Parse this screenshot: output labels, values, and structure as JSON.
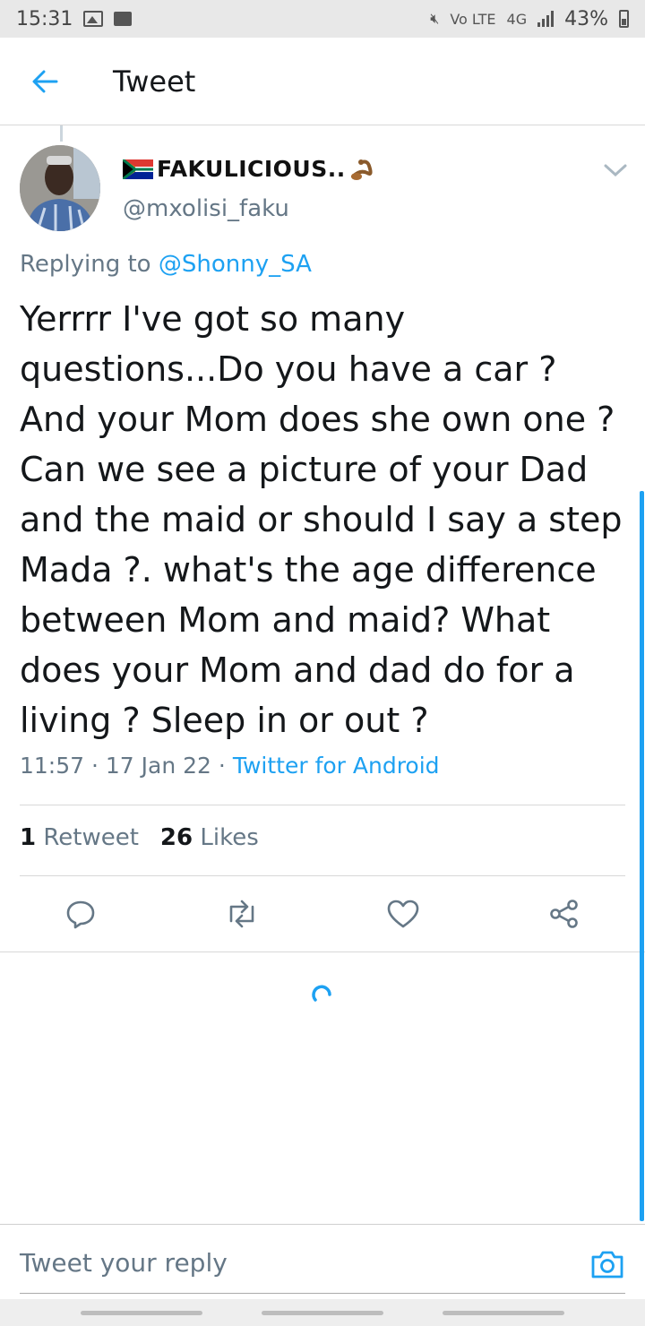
{
  "status_bar": {
    "time": "15:31",
    "volte": "Vo LTE",
    "network": "4G",
    "battery": "43%"
  },
  "app_bar": {
    "title": "Tweet"
  },
  "tweet": {
    "display_name": "FAKULICIOUS..",
    "handle": "@mxolisi_faku",
    "replying_to_prefix": "Replying to",
    "replying_to_mention": "@Shonny_SA",
    "text": "Yerrrr I've got so many questions...Do you have a car ? And your Mom does she own one ? Can we see a picture of your Dad and the maid or should I say a step Mada ?. what's the age difference between Mom and maid? What does your Mom and dad do for a living ? Sleep in or out ?",
    "time": "11:57",
    "date": "17 Jan 22",
    "client": "Twitter for Android",
    "retweet_count": "1",
    "retweet_label": "Retweet",
    "like_count": "26",
    "like_label": "Likes"
  },
  "icons": {
    "back": "arrow-left-icon",
    "more": "chevron-down-icon",
    "reply": "reply-icon",
    "retweet": "retweet-icon",
    "like": "heart-icon",
    "share": "share-icon",
    "camera": "camera-icon"
  },
  "reply_box": {
    "placeholder": "Tweet your reply"
  },
  "colors": {
    "accent": "#1da1f2",
    "secondary_text": "#657786"
  }
}
